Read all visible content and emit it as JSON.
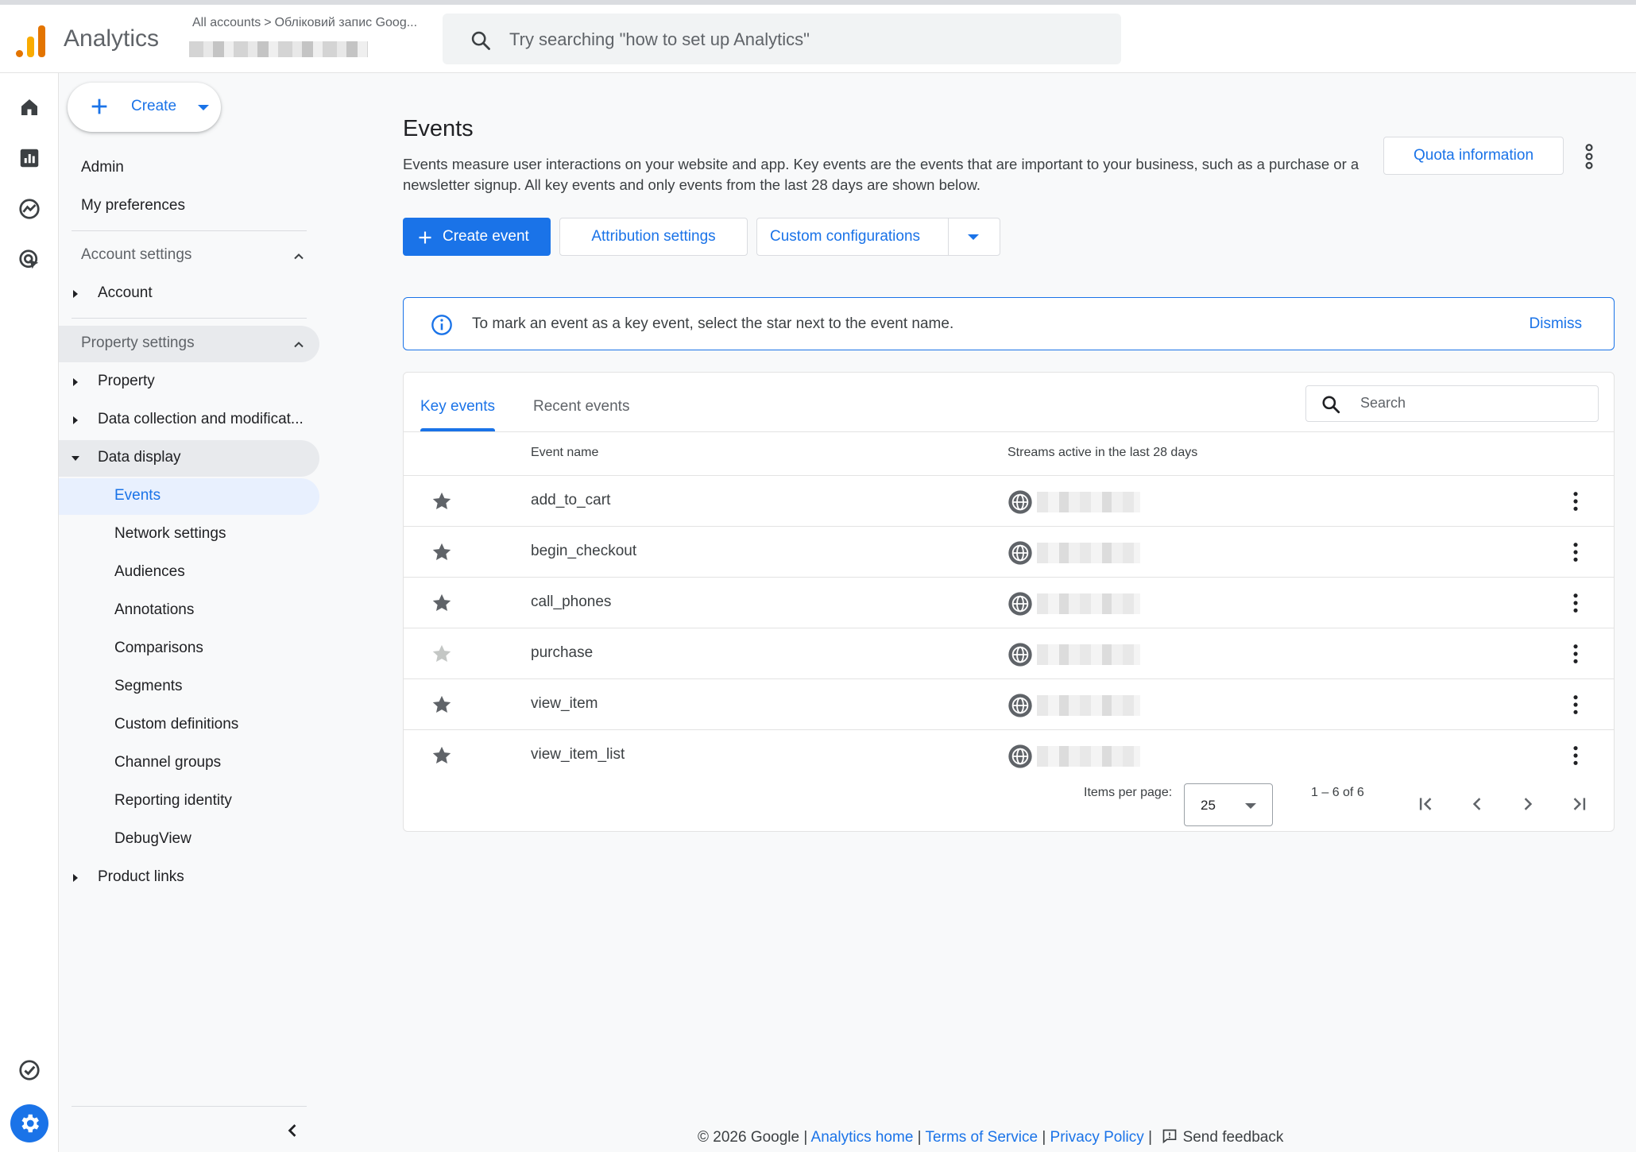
{
  "header": {
    "app_title": "Analytics",
    "breadcrumb_root": "All accounts",
    "breadcrumb_account": "Обліковий запис Goog...",
    "search_placeholder": "Try searching \"how to set up Analytics\""
  },
  "rail": {
    "items": [
      {
        "name": "home-icon"
      },
      {
        "name": "reports-icon"
      },
      {
        "name": "explore-icon"
      },
      {
        "name": "advertising-icon"
      }
    ],
    "bottom": [
      {
        "name": "check-circle-icon"
      },
      {
        "name": "gear-icon"
      }
    ]
  },
  "sidenav": {
    "create_label": "Create",
    "admin": "Admin",
    "my_preferences": "My preferences",
    "account_settings": "Account settings",
    "account": "Account",
    "property_settings": "Property settings",
    "property": "Property",
    "data_collection": "Data collection and modificat...",
    "data_display": "Data display",
    "sub_items": [
      "Events",
      "Network settings",
      "Audiences",
      "Annotations",
      "Comparisons",
      "Segments",
      "Custom definitions",
      "Channel groups",
      "Reporting identity",
      "DebugView"
    ],
    "product_links": "Product links"
  },
  "main": {
    "title": "Events",
    "description": "Events measure user interactions on your website and app. Key events are the events that are important to your business, such as a purchase or a newsletter signup. All key events and only events from the last 28 days are shown below.",
    "quota_button": "Quota information",
    "create_event_button": "Create event",
    "attribution_button": "Attribution settings",
    "custom_config_button": "Custom configurations"
  },
  "banner": {
    "message": "To mark an event as a key event, select the star next to the event name.",
    "dismiss": "Dismiss"
  },
  "table": {
    "tabs": [
      "Key events",
      "Recent events"
    ],
    "search_placeholder": "Search",
    "columns": [
      "Event name",
      "Streams active in the last 28 days"
    ],
    "rows": [
      {
        "name": "add_to_cart",
        "key": true
      },
      {
        "name": "begin_checkout",
        "key": true
      },
      {
        "name": "call_phones",
        "key": true
      },
      {
        "name": "purchase",
        "key": false
      },
      {
        "name": "view_item",
        "key": true
      },
      {
        "name": "view_item_list",
        "key": true
      }
    ],
    "items_per_page_label": "Items per page:",
    "items_per_page": "25",
    "range": "1 – 6 of 6"
  },
  "footer": {
    "copyright": "© 2026 Google",
    "analytics_home": "Analytics home",
    "terms": "Terms of Service",
    "privacy": "Privacy Policy",
    "send_feedback": "Send feedback",
    "separator": "|"
  },
  "colors": {
    "accent": "#1a73e8",
    "logo_dark": "#e37400",
    "logo_light": "#f9ab00",
    "star_active": "#5f6368",
    "star_inactive": "#c4c7c5"
  }
}
